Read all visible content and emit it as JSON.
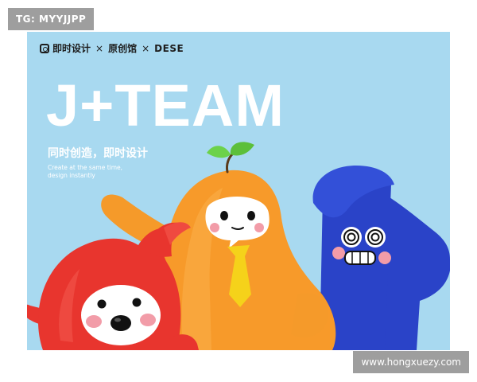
{
  "watermark_top": "TG: MYYJJPP",
  "watermark_bottom": "www.hongxuezy.com",
  "poster": {
    "brand": [
      "即时设计",
      "原创馆",
      "DESE"
    ],
    "brand_separator": "×",
    "title": "J+TEAM",
    "slogan": "同时创造，即时设计",
    "subtitle_lines": [
      "Create at the same time,",
      "design instantly"
    ],
    "background": "#a8d9f0"
  },
  "mascots": [
    {
      "name": "red-mascot",
      "color": "#e8352e"
    },
    {
      "name": "orange-mascot",
      "color": "#f79a2a",
      "leaf_color": "#5cbf3a",
      "tie_color": "#f5d21a"
    },
    {
      "name": "blue-mascot",
      "color": "#2a43c8"
    }
  ]
}
